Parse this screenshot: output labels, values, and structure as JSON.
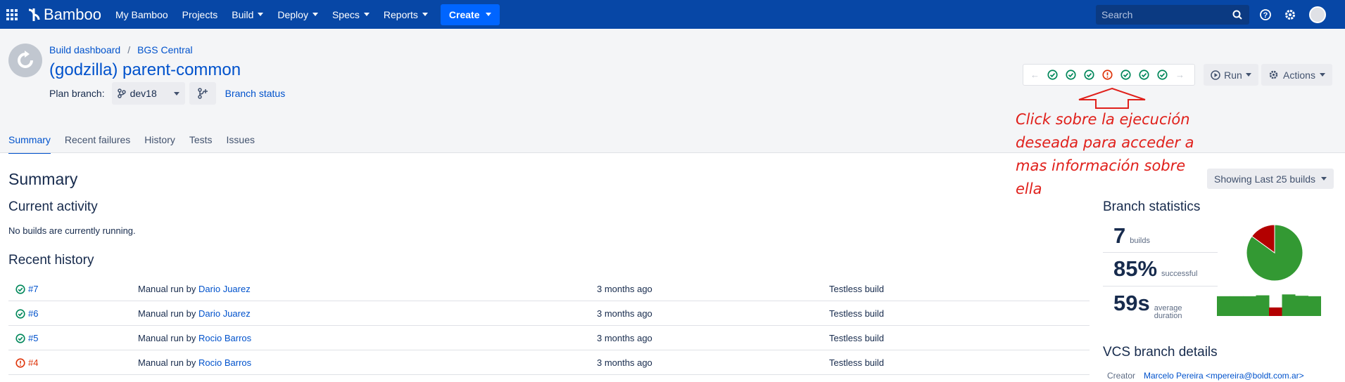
{
  "nav": {
    "app_name": "Bamboo",
    "items": [
      {
        "label": "My Bamboo",
        "dropdown": false
      },
      {
        "label": "Projects",
        "dropdown": false
      },
      {
        "label": "Build",
        "dropdown": true
      },
      {
        "label": "Deploy",
        "dropdown": true
      },
      {
        "label": "Specs",
        "dropdown": true
      },
      {
        "label": "Reports",
        "dropdown": true
      }
    ],
    "create_label": "Create",
    "search_placeholder": "Search",
    "brand_color": "#0747a6",
    "icons": [
      "apps-icon",
      "help-icon",
      "settings-icon",
      "user-avatar"
    ]
  },
  "header": {
    "breadcrumb": [
      "Build dashboard",
      "BGS Central"
    ],
    "breadcrumb_separator": "/",
    "plan_title": "(godzilla) parent-common",
    "plan_branch_label": "Plan branch:",
    "branch_value": "dev18",
    "branch_status_label": "Branch status"
  },
  "build_strip": {
    "statuses": [
      "success",
      "success",
      "success",
      "failed",
      "success",
      "success",
      "success"
    ],
    "success_color": "#36b37e",
    "failed_color": "#de350b"
  },
  "buttons": {
    "run": "Run",
    "actions": "Actions",
    "showing": "Showing Last 25 builds"
  },
  "tabs": [
    {
      "label": "Summary",
      "active": true
    },
    {
      "label": "Recent failures",
      "active": false
    },
    {
      "label": "History",
      "active": false
    },
    {
      "label": "Tests",
      "active": false
    },
    {
      "label": "Issues",
      "active": false
    }
  ],
  "annotation": {
    "text_lines": [
      "Click sobre la ejecución",
      "deseada para acceder a",
      "mas información sobre",
      "ella"
    ],
    "color": "#e0201b"
  },
  "summary": {
    "title": "Summary",
    "current_activity_title": "Current activity",
    "current_activity_text": "No builds are currently running.",
    "recent_history_title": "Recent history",
    "history": [
      {
        "number": "#7",
        "status": "success",
        "trigger_prefix": "Manual run by",
        "user": "Dario Juarez",
        "ago": "3 months ago",
        "tests": "Testless build"
      },
      {
        "number": "#6",
        "status": "success",
        "trigger_prefix": "Manual run by",
        "user": "Dario Juarez",
        "ago": "3 months ago",
        "tests": "Testless build"
      },
      {
        "number": "#5",
        "status": "success",
        "trigger_prefix": "Manual run by",
        "user": "Rocio Barros",
        "ago": "3 months ago",
        "tests": "Testless build"
      },
      {
        "number": "#4",
        "status": "failed",
        "trigger_prefix": "Manual run by",
        "user": "Rocio Barros",
        "ago": "3 months ago",
        "tests": "Testless build"
      }
    ]
  },
  "branch_stats": {
    "title": "Branch statistics",
    "builds_value": "7",
    "builds_label": "builds",
    "success_value": "85%",
    "success_label": "successful",
    "duration_value": "59s",
    "duration_label_1": "average",
    "duration_label_2": "duration",
    "success_fraction": 0.85,
    "pie_colors": {
      "success": "#339933",
      "failed": "#b30000"
    },
    "duration_bars": [
      {
        "level": 0.88,
        "status": "success"
      },
      {
        "level": 0.88,
        "status": "success"
      },
      {
        "level": 0.88,
        "status": "success"
      },
      {
        "level": 0.92,
        "status": "success"
      },
      {
        "level": 0.38,
        "status": "failed"
      },
      {
        "level": 0.96,
        "status": "success"
      },
      {
        "level": 0.9,
        "status": "success"
      },
      {
        "level": 0.88,
        "status": "success"
      }
    ]
  },
  "vcs": {
    "title": "VCS branch details",
    "creator_label": "Creator",
    "creator_value": "Marcelo Pereira <mpereira@boldt.com.ar>"
  }
}
